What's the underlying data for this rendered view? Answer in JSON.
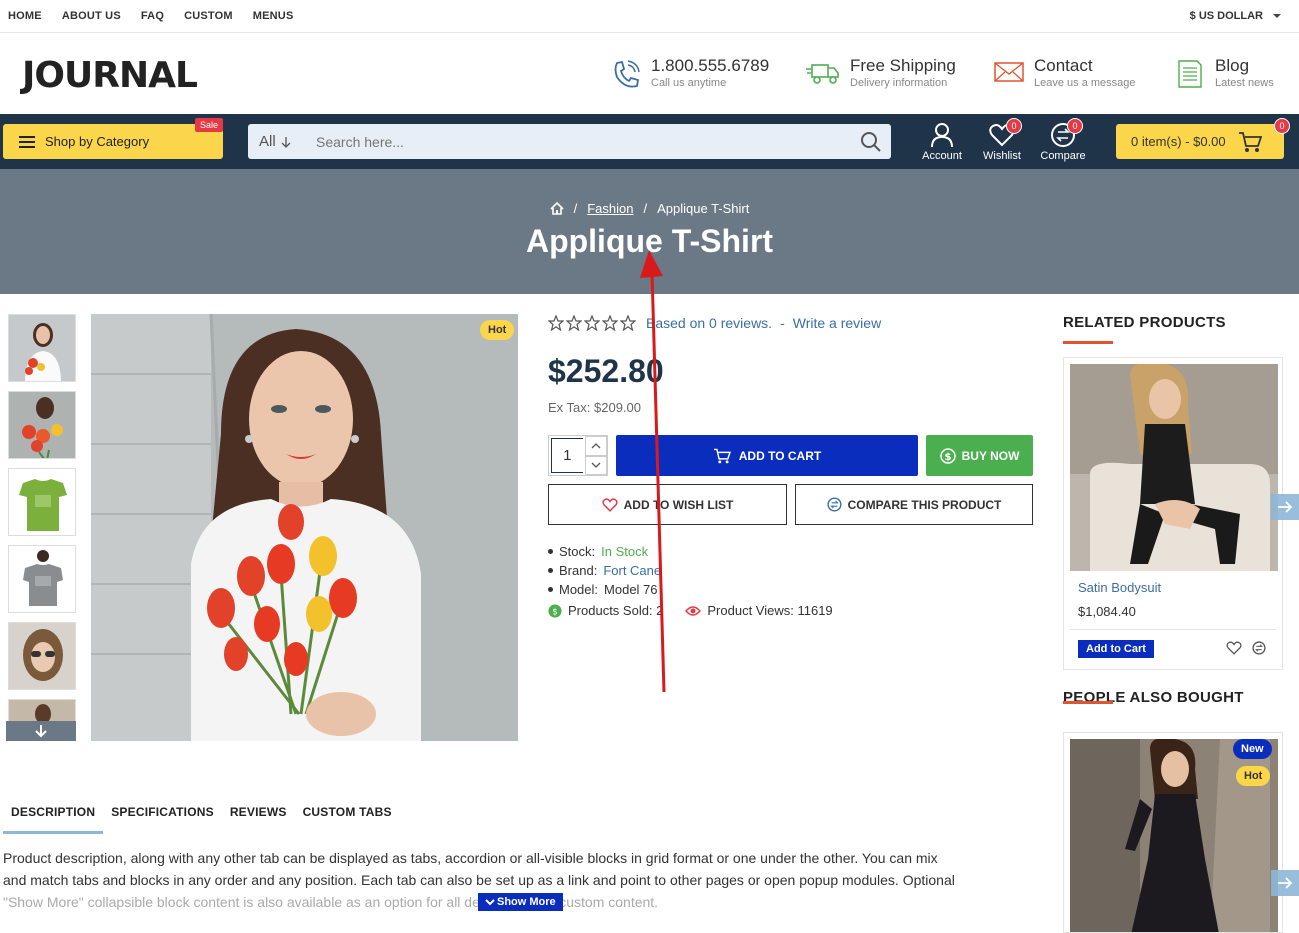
{
  "topnav": {
    "links": [
      "HOME",
      "ABOUT US",
      "FAQ",
      "CUSTOM",
      "MENUS"
    ],
    "currency": "$ US DOLLAR"
  },
  "header": {
    "logo": "JOURNAL",
    "phone": {
      "title": "1.800.555.6789",
      "sub": "Call us anytime"
    },
    "shipping": {
      "title": "Free Shipping",
      "sub": "Delivery information"
    },
    "contact": {
      "title": "Contact",
      "sub": "Leave us a message"
    },
    "blog": {
      "title": "Blog",
      "sub": "Latest news"
    }
  },
  "navbar": {
    "shop_by_category": "Shop by Category",
    "sale_badge": "Sale",
    "search_category": "All",
    "search_placeholder": "Search here...",
    "account": "Account",
    "wishlist": "Wishlist",
    "wishlist_count": "0",
    "compare": "Compare",
    "compare_count": "0",
    "cart": "0 item(s) - $0.00",
    "cart_count": "0"
  },
  "breadcrumb": {
    "category": "Fashion",
    "current": "Applique T-Shirt"
  },
  "page_title": "Applique T-Shirt",
  "product": {
    "hot_badge": "Hot",
    "reviews_text": "Based on 0 reviews.",
    "separator": "-",
    "write_review": "Write a review",
    "price": "$252.80",
    "ex_tax": "Ex Tax: $209.00",
    "quantity": "1",
    "add_to_cart": "ADD TO CART",
    "buy_now": "BUY NOW",
    "add_to_wishlist": "ADD TO WISH LIST",
    "compare": "COMPARE THIS PRODUCT",
    "stock_label": "Stock:",
    "stock_value": "In Stock",
    "brand_label": "Brand:",
    "brand_value": "Fort Cane",
    "model_label": "Model:",
    "model_value": "Model 76",
    "products_sold": "Products Sold: 2",
    "product_views": "Product Views: 11619"
  },
  "sidebar": {
    "related_title": "RELATED PRODUCTS",
    "related_product": {
      "name": "Satin Bodysuit",
      "price": "$1,084.40",
      "add_to_cart": "Add to Cart"
    },
    "also_bought_title": "PEOPLE ALSO BOUGHT",
    "also_badges": {
      "new": "New",
      "hot": "Hot"
    }
  },
  "tabs": [
    "DESCRIPTION",
    "SPECIFICATIONS",
    "REVIEWS",
    "CUSTOM TABS"
  ],
  "description": {
    "line1": "Product description, along with any other tab can be displayed as tabs, accordion or all-visible blocks in grid format or one under the other.  You can mix",
    "line2": "and match tabs and blocks in any order and any position. Each tab can also be set up as a link and point to other pages or open popup modules. Optional",
    "line3": "\"Show More\" collapsible block content is also available as an option for all descriptions or custom content.",
    "show_more": "Show More"
  },
  "colors": {
    "navbar": "#1f3349",
    "accent_yellow": "#fbd64a",
    "primary_blue": "#0b2dbe",
    "buy_green": "#4caf4f",
    "title_band": "#6b7885",
    "sale_red": "#e63946",
    "annotation_arrow": "#d91a1a"
  }
}
